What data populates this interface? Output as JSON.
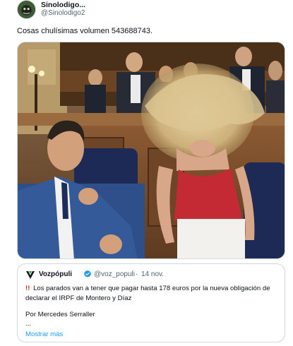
{
  "author": {
    "name": "Sinolodigo...",
    "handle": "@Sinolodigo2"
  },
  "tweet": {
    "text": "Cosas chulísimas volumen 543688743."
  },
  "quoted_tweet": {
    "author_name": "Vozpópuli",
    "author_handle": "@voz_populi",
    "separator": "·",
    "date": "14 nov.",
    "alarm_icon": "!!",
    "body": "Los parados van a tener que pagar hasta 178 euros por la nueva obligación de declarar el IRPF de Montero y Díaz",
    "byline": "Por Mercedes Serraller",
    "ellipsis": "...",
    "show_more": "Mostrar más"
  },
  "colors": {
    "link": "#1d9bf0",
    "verified": "#1d9bf0",
    "alarm": "#d71f1f",
    "secondary_text": "#536471"
  },
  "icons": {
    "avatar": "avatar-image",
    "quote_logo": "vozpopuli-logo",
    "verified": "verified-badge-icon"
  }
}
